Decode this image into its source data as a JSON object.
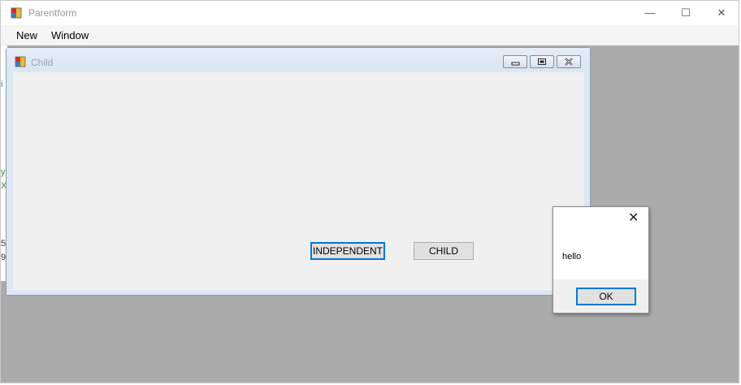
{
  "parent": {
    "title": "Parentform",
    "controls": {
      "minimize": "—",
      "maximize": "☐",
      "close": "✕"
    },
    "menu": [
      "New",
      "Window"
    ]
  },
  "background_fragments": [
    "i",
    "y",
    "X",
    "5",
    "9"
  ],
  "child": {
    "title": "Child",
    "buttons": {
      "independent": "INDEPENDENT",
      "child": "CHILD"
    }
  },
  "message_box": {
    "text": "hello",
    "ok_label": "OK",
    "close_glyph": "✕"
  },
  "colors": {
    "mdi_background": "#ababab",
    "focus_accent": "#0078d7",
    "fragment_text_blue": "#2c7fa8",
    "fragment_text_green": "#2b8a2b"
  }
}
